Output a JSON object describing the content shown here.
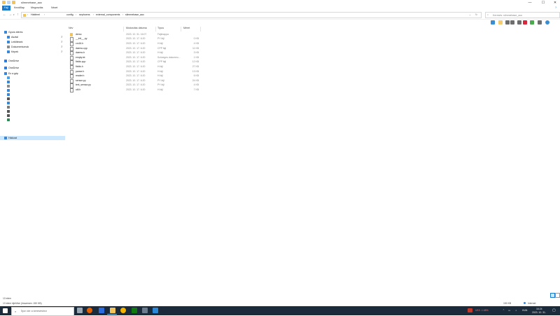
{
  "window": {
    "title": "slimmebase_aoc",
    "controls": {
      "minimize": "—",
      "maximize": "☐",
      "close": "✕"
    }
  },
  "ribbon": {
    "tabs": [
      "Fájl",
      "Kezdőlap",
      "Megosztás",
      "Nézet"
    ]
  },
  "address": {
    "crumbs": [
      "Háttéret",
      "config",
      "sephoens",
      "external_components",
      "slimmebase_aoc"
    ],
    "search_placeholder": "Keresés: slimmebase_aoc"
  },
  "nav": {
    "items": [
      {
        "label": "Gyors elérés",
        "icon": "star-icon",
        "color": "#3a87d8",
        "pinned": false,
        "indent": 0
      },
      {
        "label": "Asztal",
        "icon": "desktop-icon",
        "color": "#3a87d8",
        "pinned": true,
        "indent": 1
      },
      {
        "label": "Letöltések",
        "icon": "download-icon",
        "color": "#3a87d8",
        "pinned": true,
        "indent": 1
      },
      {
        "label": "Dokumentumok",
        "icon": "documents-icon",
        "color": "#8a8a8a",
        "pinned": true,
        "indent": 1
      },
      {
        "label": "Képek",
        "icon": "pictures-icon",
        "color": "#3a87d8",
        "pinned": true,
        "indent": 1
      },
      {
        "label": "OneDrive",
        "icon": "cloud-icon",
        "color": "#2d7be0",
        "pinned": false,
        "indent": 0
      },
      {
        "label": "OneDrive",
        "icon": "cloud-icon",
        "color": "#2d7be0",
        "pinned": false,
        "indent": 0
      },
      {
        "label": "Ez a gép",
        "icon": "computer-icon",
        "color": "#3a87d8",
        "pinned": false,
        "indent": 0
      },
      {
        "label": "",
        "icon": "objects-3d-icon",
        "color": "#4aa3e8",
        "pinned": false,
        "indent": 1
      },
      {
        "label": "",
        "icon": "desktop-icon",
        "color": "#3a87d8",
        "pinned": false,
        "indent": 1
      },
      {
        "label": "",
        "icon": "documents-icon",
        "color": "#8a8a8a",
        "pinned": false,
        "indent": 1
      },
      {
        "label": "",
        "icon": "pictures-icon",
        "color": "#3a87d8",
        "pinned": false,
        "indent": 1
      },
      {
        "label": "",
        "icon": "download-icon",
        "color": "#3a87d8",
        "pinned": false,
        "indent": 1
      },
      {
        "label": "",
        "icon": "video-icon",
        "color": "#555555",
        "pinned": false,
        "indent": 1
      },
      {
        "label": "",
        "icon": "music-icon",
        "color": "#3a87d8",
        "pinned": false,
        "indent": 1
      },
      {
        "label": "",
        "icon": "drive-icon",
        "color": "#7a7a7a",
        "pinned": false,
        "indent": 1
      },
      {
        "label": "",
        "icon": "drive-icon",
        "color": "#555555",
        "pinned": false,
        "indent": 1
      },
      {
        "label": "",
        "icon": "drive-icon",
        "color": "#555555",
        "pinned": false,
        "indent": 1
      },
      {
        "label": "",
        "icon": "drive-icon",
        "color": "#2e8b57",
        "pinned": false,
        "indent": 1
      },
      {
        "label": "Hálózat",
        "icon": "network-icon",
        "color": "#3a87d8",
        "pinned": false,
        "indent": 0,
        "selected": true
      }
    ]
  },
  "filelist": {
    "headers": {
      "name": "Név",
      "date": "Módosítás dátuma",
      "type": "Típus",
      "size": "Méret"
    },
    "rows": [
      {
        "name": "demo",
        "date": "2023. 10. 31. 16:07",
        "type": "Fájlmappa",
        "size": "",
        "kind": "folder"
      },
      {
        "name": "__init__.py",
        "date": "2023. 10. 17. 6:20",
        "type": "PY fájl",
        "size": "0 KB",
        "kind": "file"
      },
      {
        "name": "crc16.h",
        "date": "2023. 10. 17. 6:20",
        "type": "H fájl",
        "size": "4 KB",
        "kind": "file"
      },
      {
        "name": "daemo.cpp",
        "date": "2023. 10. 17. 6:20",
        "type": "CPP fájl",
        "size": "11 KB",
        "kind": "file"
      },
      {
        "name": "daemo.h",
        "date": "2023. 10. 17. 6:20",
        "type": "H fájl",
        "size": "3 KB",
        "kind": "file"
      },
      {
        "name": "empty.txt",
        "date": "2023. 10. 17. 6:20",
        "type": "Szöveges dokumeu...",
        "size": "1 KB",
        "kind": "file"
      },
      {
        "name": "fields.cpp",
        "date": "2023. 10. 17. 6:20",
        "type": "CPP fájl",
        "size": "12 KB",
        "kind": "file"
      },
      {
        "name": "fields.h",
        "date": "2023. 10. 17. 6:20",
        "type": "H fájl",
        "size": "27 KB",
        "kind": "file"
      },
      {
        "name": "parser.h",
        "date": "2023. 10. 17. 6:20",
        "type": "H fájl",
        "size": "13 KB",
        "kind": "file"
      },
      {
        "name": "reader.h",
        "date": "2023. 10. 17. 6:20",
        "type": "H fájl",
        "size": "6 KB",
        "kind": "file"
      },
      {
        "name": "sensor.py",
        "date": "2023. 10. 17. 6:20",
        "type": "PY fájl",
        "size": "24 KB",
        "kind": "file"
      },
      {
        "name": "text_sensor.py",
        "date": "2023. 10. 17. 6:20",
        "type": "PY fájl",
        "size": "4 KB",
        "kind": "file"
      },
      {
        "name": "util.h",
        "date": "2023. 10. 17. 6:20",
        "type": "H fájl",
        "size": "7 KB",
        "kind": "file"
      }
    ]
  },
  "status": {
    "count": "13 elem",
    "selection": "13 elem kijelölve (összesen: 150 KB)",
    "size": "150 KB",
    "zone": "Internet"
  },
  "taskbar": {
    "search_placeholder": "Írjon ide a kereséshez",
    "ticker": "UKX   -1.68%",
    "lang": "HUN",
    "time": "16:24",
    "date": "2023. 10. 31.",
    "apps": [
      {
        "icon": "task-view-icon",
        "color": "#9aa7b4"
      },
      {
        "icon": "firefox-icon",
        "color": "#e66000"
      },
      {
        "icon": "media-app-icon",
        "color": "#2d6cdf"
      },
      {
        "icon": "file-explorer-icon",
        "color": "#f2c45a"
      },
      {
        "icon": "chrome-icon",
        "color": "#f4b400"
      },
      {
        "icon": "app-green-icon",
        "color": "#0f7b0f"
      },
      {
        "icon": "calculator-icon",
        "color": "#6b7c8f"
      },
      {
        "icon": "app-blue-icon",
        "color": "#2b88d8"
      }
    ]
  },
  "toolbar": {
    "buttons": [
      {
        "icon": "layout-icon",
        "color": "#1979ca"
      },
      {
        "icon": "note-icon",
        "color": "#f2c45a"
      },
      {
        "icon": "cut-icon",
        "color": "#555555"
      },
      {
        "icon": "copy-icon",
        "color": "#555555"
      },
      {
        "icon": "paste-icon",
        "color": "#555555"
      },
      {
        "icon": "delete-icon",
        "color": "#d0021b"
      },
      {
        "icon": "check-icon",
        "color": "#2e9a2e"
      },
      {
        "icon": "share-icon",
        "color": "#555555"
      },
      {
        "icon": "globe-icon",
        "color": "#1979ca"
      }
    ]
  }
}
